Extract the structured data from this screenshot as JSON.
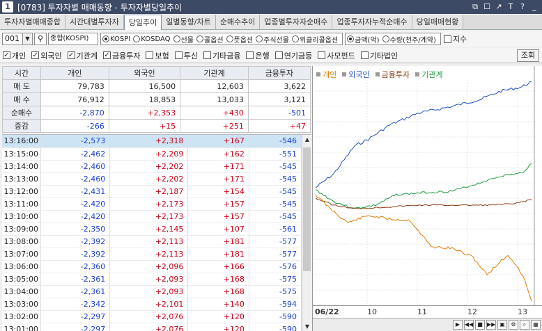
{
  "window": {
    "number": "1",
    "title": "[0783] 투자자별 매매동향 - 투자자별당일추이"
  },
  "tabs": [
    "투자자별매매종합",
    "시간대별투자자",
    "당일추이",
    "일별동향/차트",
    "순매수추이",
    "업종별투자자순매수",
    "업종투자자누적순매수",
    "당일매매현황"
  ],
  "active_tab": 2,
  "filters": {
    "code": "001",
    "market": "종합(KOSPI)",
    "market_radios": [
      {
        "label": "KOSPI",
        "on": true
      },
      {
        "label": "KOSDAQ",
        "on": false
      },
      {
        "label": "선물",
        "on": false
      },
      {
        "label": "콜옵션",
        "on": false
      },
      {
        "label": "풋옵션",
        "on": false
      },
      {
        "label": "주식선물",
        "on": false
      },
      {
        "label": "위클리콜옵션",
        "on": false
      }
    ],
    "unit_radios": [
      {
        "label": "금액(억)",
        "on": true
      },
      {
        "label": "수량(천주/계약)",
        "on": false
      }
    ],
    "extra_check": "지수"
  },
  "investor_checks": [
    {
      "label": "개인",
      "on": true
    },
    {
      "label": "외국인",
      "on": true
    },
    {
      "label": "기관계",
      "on": true
    },
    {
      "label": "금융투자",
      "on": true
    },
    {
      "label": "보험",
      "on": false
    },
    {
      "label": "투신",
      "on": false
    },
    {
      "label": "기타금융",
      "on": false
    },
    {
      "label": "은행",
      "on": false
    },
    {
      "label": "연기금등",
      "on": false
    },
    {
      "label": "사모펀드",
      "on": false
    },
    {
      "label": "기타법인",
      "on": false
    }
  ],
  "lookup_label": "조회",
  "summary": {
    "headers": [
      "시간",
      "개인",
      "외국인",
      "기관계",
      "금융투자"
    ],
    "rows": [
      {
        "label": "매 도",
        "values": [
          "79,783",
          "16,500",
          "12,603",
          "3,622"
        ]
      },
      {
        "label": "매 수",
        "values": [
          "76,912",
          "18,853",
          "13,033",
          "3,121"
        ]
      },
      {
        "label": "순매수",
        "values": [
          "-2,870",
          "+2,353",
          "+430",
          "-501"
        ]
      },
      {
        "label": "증감",
        "values": [
          "-266",
          "+15",
          "+251",
          "+47"
        ]
      }
    ]
  },
  "time_rows": [
    [
      "13:16:00",
      "-2,573",
      "+2,318",
      "+167",
      "-546"
    ],
    [
      "13:15:00",
      "-2,462",
      "+2,209",
      "+162",
      "-551"
    ],
    [
      "13:14:00",
      "-2,460",
      "+2,202",
      "+171",
      "-545"
    ],
    [
      "13:13:00",
      "-2,460",
      "+2,202",
      "+171",
      "-545"
    ],
    [
      "13:12:00",
      "-2,431",
      "+2,187",
      "+154",
      "-545"
    ],
    [
      "13:11:00",
      "-2,420",
      "+2,173",
      "+157",
      "-545"
    ],
    [
      "13:10:00",
      "-2,420",
      "+2,173",
      "+157",
      "-545"
    ],
    [
      "13:09:00",
      "-2,350",
      "+2,145",
      "+107",
      "-561"
    ],
    [
      "13:08:00",
      "-2,392",
      "+2,113",
      "+181",
      "-577"
    ],
    [
      "13:07:00",
      "-2,392",
      "+2,113",
      "+181",
      "-577"
    ],
    [
      "13:06:00",
      "-2,360",
      "+2,096",
      "+166",
      "-576"
    ],
    [
      "13:05:00",
      "-2,361",
      "+2,093",
      "+168",
      "-575"
    ],
    [
      "13:04:00",
      "-2,361",
      "+2,093",
      "+168",
      "-575"
    ],
    [
      "13:03:00",
      "-2,342",
      "+2,101",
      "+140",
      "-594"
    ],
    [
      "13:02:00",
      "-2,297",
      "+2,076",
      "+120",
      "-590"
    ],
    [
      "13:01:00",
      "-2,297",
      "+2,076",
      "+120",
      "-590"
    ]
  ],
  "chart": {
    "legend": [
      {
        "label": "개인",
        "color": "#e07b00"
      },
      {
        "label": "외국인",
        "color": "#1f4fbf"
      },
      {
        "label": "금융투자",
        "color": "#8a3b12"
      },
      {
        "label": "기관계",
        "color": "#1e9a3a"
      }
    ],
    "x_ticks": [
      "06/22",
      "10",
      "11",
      "12",
      "13"
    ]
  },
  "colors": {
    "positive": "#d0021b",
    "negative": "#1a3fcf"
  }
}
